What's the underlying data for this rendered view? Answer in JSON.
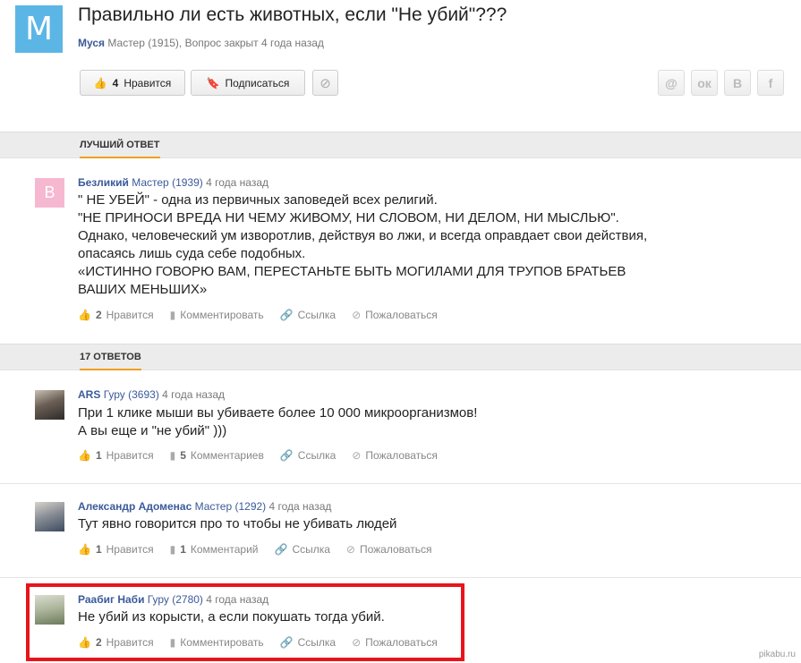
{
  "question": {
    "avatar_letter": "M",
    "title": "Правильно ли есть животных, если \"Не убий\"???",
    "author": "Муся",
    "meta": "Мастер (1915), Вопрос закрыт 4 года назад",
    "like_count": "4",
    "like_label": "Нравится",
    "subscribe_label": "Подписаться",
    "share": [
      "@",
      "ок",
      "В",
      "f"
    ]
  },
  "best_answer": {
    "section_title": "ЛУЧШИЙ ОТВЕТ",
    "avatar_letter": "B",
    "author": "Безликий",
    "rank": "Мастер (1939)",
    "time": "4 года назад",
    "lines": [
      "\" НЕ УБЕЙ\" - одна из первичных заповедей всех религий.",
      "\"НЕ ПРИНОСИ ВРЕДА НИ ЧЕМУ ЖИВОМУ, НИ СЛОВОМ, НИ ДЕЛОМ, НИ МЫСЛЬЮ\".",
      "Однако, человеческий ум изворотлив, действуя во лжи, и всегда оправдает свои действия,",
      "опасаясь лишь суда себе подобных.",
      "«ИСТИННО ГОВОРЮ ВАМ, ПЕРЕСТАНЬТЕ БЫТЬ МОГИЛАМИ ДЛЯ ТРУПОВ БРАТЬЕВ",
      "ВАШИХ МЕНЬШИХ»"
    ],
    "likes": "2",
    "like_label": "Нравится",
    "comment_label": "Комментировать",
    "link_label": "Ссылка",
    "report_label": "Пожаловаться"
  },
  "answers_section": {
    "count_title": "17 ОТВЕТОВ"
  },
  "answers": [
    {
      "author": "ARS",
      "rank": "Гуру (3693)",
      "time": "4 года назад",
      "lines": [
        "При 1 клике мыши вы убиваете более 10 000 микроорганизмов!",
        "А вы еще и \"не убий\" )))"
      ],
      "likes": "1",
      "like_label": "Нравится",
      "comments_count": "5",
      "comment_label": "Комментариев",
      "link_label": "Ссылка",
      "report_label": "Пожаловаться"
    },
    {
      "author": "Александр Адоменас",
      "rank": "Мастер (1292)",
      "time": "4 года назад",
      "lines": [
        "Тут явно говорится про то чтобы не убивать людей"
      ],
      "likes": "1",
      "like_label": "Нравится",
      "comments_count": "1",
      "comment_label": "Комментарий",
      "link_label": "Ссылка",
      "report_label": "Пожаловаться"
    },
    {
      "author": "Раабиг Наби",
      "rank": "Гуру (2780)",
      "time": "4 года назад",
      "lines": [
        "Не убий из корысти, а если покушать тогда убий."
      ],
      "likes": "2",
      "like_label": "Нравится",
      "comment_label": "Комментировать",
      "link_label": "Ссылка",
      "report_label": "Пожаловаться"
    }
  ],
  "watermark": "pikabu.ru",
  "colors": {
    "accent": "#f0a020",
    "author": "#3b5a9a",
    "highlight": "#e8141c",
    "avatar_m": "#5bb6e6"
  }
}
